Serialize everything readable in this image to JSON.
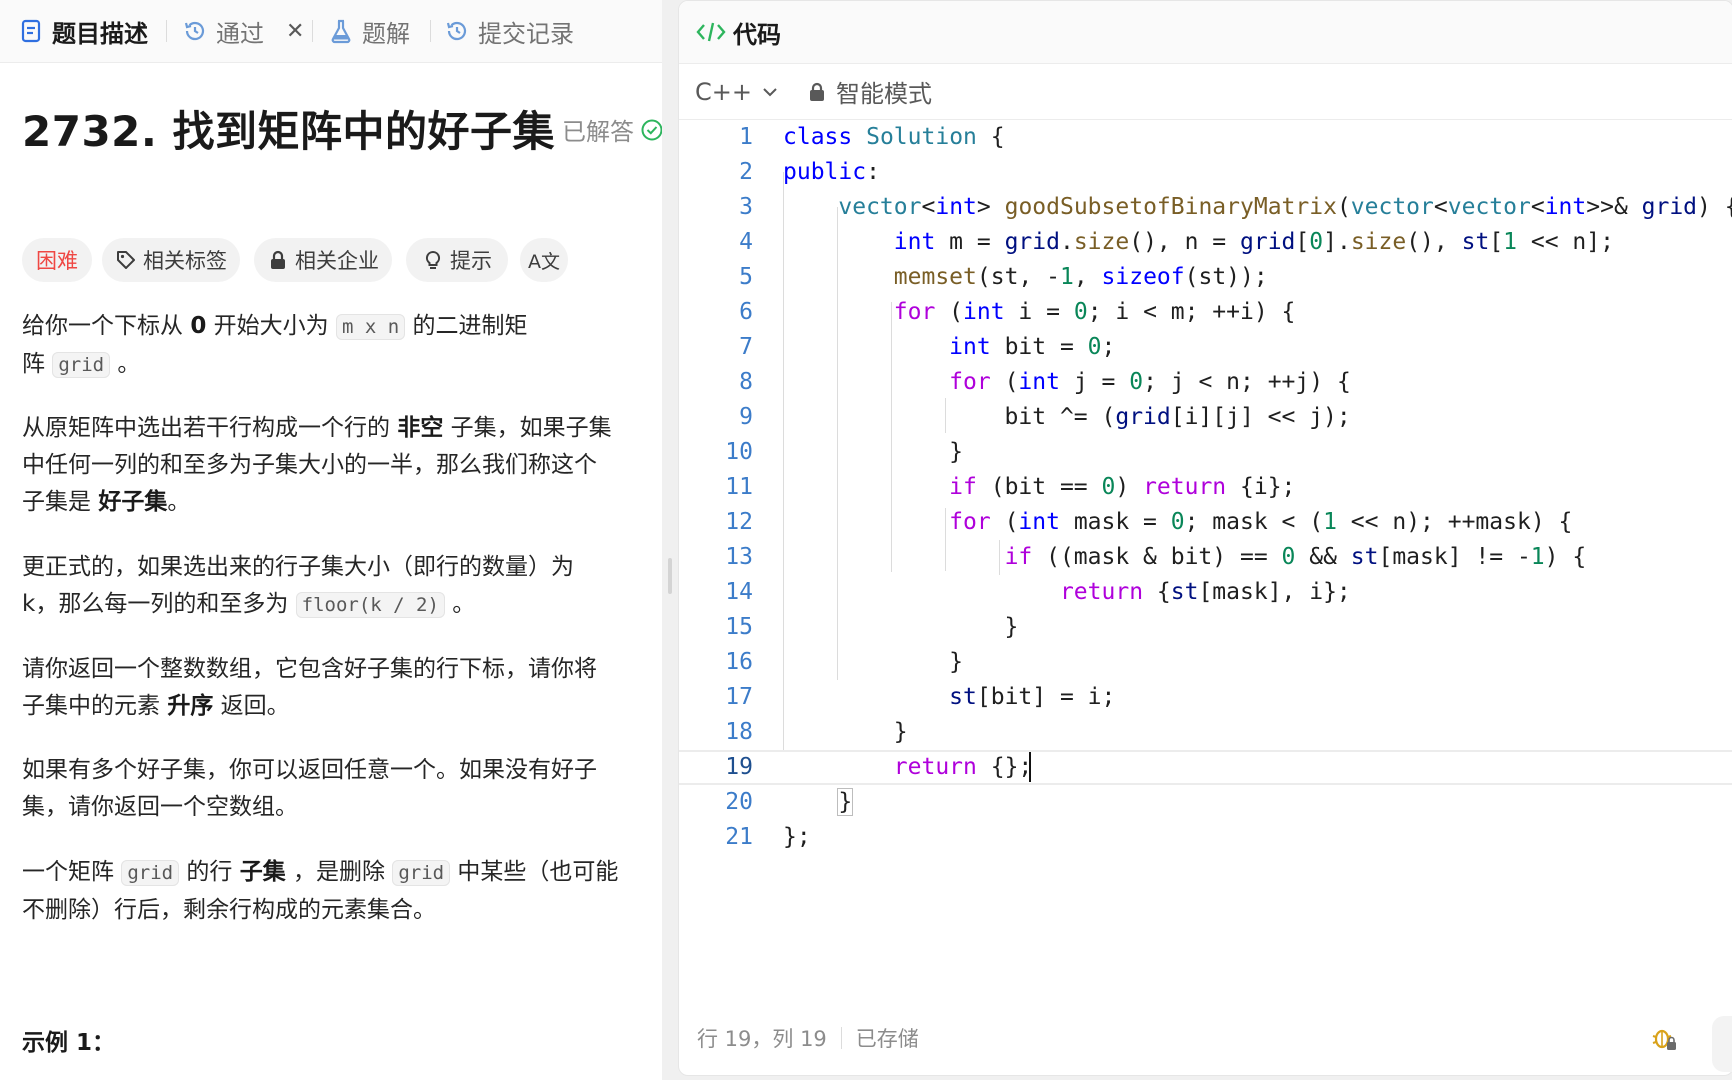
{
  "tabs": [
    {
      "label": "题目描述",
      "icon": "description-icon"
    },
    {
      "label": "通过",
      "icon": "history-icon",
      "close": "✕"
    },
    {
      "label": "题解",
      "icon": "flask-icon"
    },
    {
      "label": "提交记录",
      "icon": "history-icon"
    }
  ],
  "problem": {
    "title": "2732. 找到矩阵中的好子集",
    "status": "已解答",
    "chips": {
      "difficulty": "困难",
      "tags": "相关标签",
      "companies": "相关企业",
      "hint": "提示",
      "translate": "A文"
    },
    "desc": {
      "p1_a": "给你一个下标从 ",
      "p1_b": "0",
      "p1_c": " 开始大小为 ",
      "p1_code1": "m x n",
      "p1_d": " 的二进制矩",
      "p1_e": "阵 ",
      "p1_code2": "grid",
      "p1_f": " 。",
      "p2_a": "从原矩阵中选出若干行构成一个行的 ",
      "p2_b": "非空",
      "p2_c": " 子集，如果子集",
      "p2_d": "中任何一列的和至多为子集大小的一半，那么我们称这个",
      "p2_e": "子集是 ",
      "p2_f": "好子集",
      "p2_g": "。",
      "p3_a": "更正式的，如果选出来的行子集大小（即行的数量）为",
      "p3_b": "k，那么每一列的和至多为 ",
      "p3_code": "floor(k / 2)",
      "p3_c": " 。",
      "p4_a": "请你返回一个整数数组，它包含好子集的行下标，请你将",
      "p4_b": "子集中的元素 ",
      "p4_c": "升序",
      "p4_d": " 返回。",
      "p5_a": "如果有多个好子集，你可以返回任意一个。如果没有好子",
      "p5_b": "集，请你返回一个空数组。",
      "p6_a": "一个矩阵 ",
      "p6_code1": "grid",
      "p6_b": " 的行 ",
      "p6_c": "子集",
      "p6_d": " ，是删除 ",
      "p6_code2": "grid",
      "p6_e": " 中某些（也可能",
      "p6_f": "不删除）行后，剩余行构成的元素集合。"
    },
    "example_title": "示例 1："
  },
  "editor": {
    "tab_label": "代码",
    "language": "C++",
    "mode": "智能模式",
    "current_line": 19,
    "status_position": "行 19，列 19",
    "status_saved": "已存储",
    "line_numbers": [
      "1",
      "2",
      "3",
      "4",
      "5",
      "6",
      "7",
      "8",
      "9",
      "10",
      "11",
      "12",
      "13",
      "14",
      "15",
      "16",
      "17",
      "18",
      "19",
      "20",
      "21"
    ]
  },
  "colors": {
    "difficulty": "#ef4743",
    "keyword": "#0000ff",
    "type": "#267f99",
    "function": "#795e26",
    "number": "#098658",
    "control": "#af00db",
    "line_number": "#3c7cc9",
    "solved_check": "#2db55d"
  }
}
